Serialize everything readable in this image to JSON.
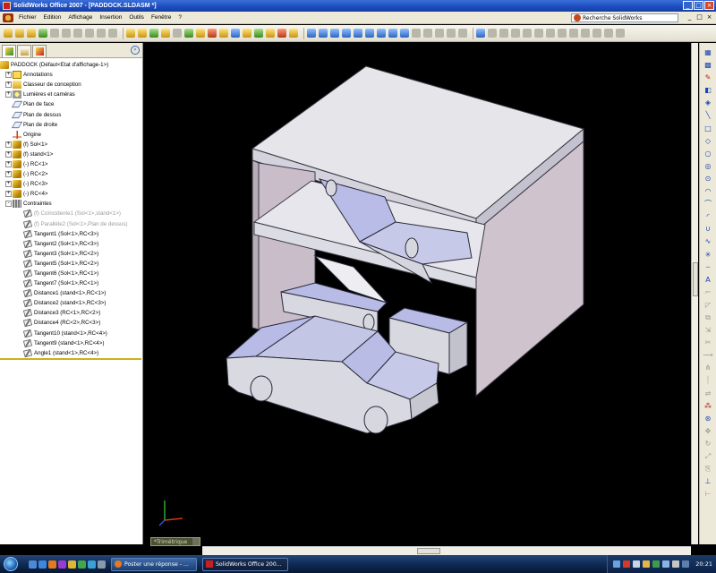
{
  "window": {
    "title": "SolidWorks Office 2007 - [PADDOCK.SLDASM *]",
    "controls": [
      "_",
      "□",
      "×"
    ]
  },
  "menu": {
    "items": [
      "Fichier",
      "Edition",
      "Affichage",
      "Insertion",
      "Outils",
      "Fenêtre",
      "?"
    ],
    "search_placeholder": "Recherche SolidWorks",
    "doc_controls": [
      "_",
      "□",
      "×"
    ]
  },
  "feature_tree": {
    "root": "PADDOCK  (Défaut<Etat d'affichage-1>)",
    "items": [
      {
        "label": "Annotations",
        "icon": "annotations-icon",
        "expand": "+"
      },
      {
        "label": "Classeur de conception",
        "icon": "design-binder-icon",
        "expand": "+"
      },
      {
        "label": "Lumières et caméras",
        "icon": "lights-cameras-icon",
        "expand": "+"
      },
      {
        "label": "Plan de face",
        "icon": "plane-icon",
        "expand": ""
      },
      {
        "label": "Plan de dessus",
        "icon": "plane-icon",
        "expand": ""
      },
      {
        "label": "Plan de droite",
        "icon": "plane-icon",
        "expand": ""
      },
      {
        "label": "Origine",
        "icon": "origin-icon",
        "expand": ""
      },
      {
        "label": "(f) Sol<1>",
        "icon": "part-icon",
        "expand": "+"
      },
      {
        "label": "(f) stand<1>",
        "icon": "part-icon",
        "expand": "+"
      },
      {
        "label": "(-) RC<1>",
        "icon": "part-icon",
        "expand": "+"
      },
      {
        "label": "(-) RC<2>",
        "icon": "part-icon",
        "expand": "+"
      },
      {
        "label": "(-) RC<3>",
        "icon": "part-icon",
        "expand": "+"
      },
      {
        "label": "(-) RC<4>",
        "icon": "part-icon",
        "expand": "+"
      },
      {
        "label": "Contraintes",
        "icon": "mates-folder-icon",
        "expand": "-"
      }
    ],
    "mates": [
      {
        "label": "(f) Coïncidente1 (Sol<1>,stand<1>)",
        "dim": true
      },
      {
        "label": "(f) Parallèle2 (Sol<1>,Plan de dessus)",
        "dim": true
      },
      {
        "label": "Tangent1 (Sol<1>,RC<3>)",
        "dim": false
      },
      {
        "label": "Tangent2 (Sol<1>,RC<3>)",
        "dim": false
      },
      {
        "label": "Tangent3 (Sol<1>,RC<2>)",
        "dim": false
      },
      {
        "label": "Tangent5 (Sol<1>,RC<2>)",
        "dim": false
      },
      {
        "label": "Tangent6 (Sol<1>,RC<1>)",
        "dim": false
      },
      {
        "label": "Tangent7 (Sol<1>,RC<1>)",
        "dim": false
      },
      {
        "label": "Distance1 (stand<1>,RC<1>)",
        "dim": false
      },
      {
        "label": "Distance2 (stand<1>,RC<3>)",
        "dim": false
      },
      {
        "label": "Distance3 (RC<1>,RC<2>)",
        "dim": false
      },
      {
        "label": "Distance4 (RC<2>,RC<3>)",
        "dim": false
      },
      {
        "label": "Tangent10 (stand<1>,RC<4>)",
        "dim": false
      },
      {
        "label": "Tangent9 (stand<1>,RC<4>)",
        "dim": false
      },
      {
        "label": "Angle1 (stand<1>,RC<4>)",
        "dim": false
      }
    ]
  },
  "viewport": {
    "view_name": "*Trimétrique",
    "background": "#000000"
  },
  "taskbar": {
    "tasks": [
      {
        "label": "Poster une réponse - ...",
        "icon": "browser-icon",
        "active": false
      },
      {
        "label": "SolidWorks Office 200...",
        "icon": "solidworks-icon",
        "active": true
      }
    ],
    "clock": "20:21"
  },
  "colors": {
    "titlebar": "#1c4cbf",
    "menu_bg": "#ece9d8",
    "model_gray": "#d6d6de",
    "model_blue": "#b9bde6"
  }
}
